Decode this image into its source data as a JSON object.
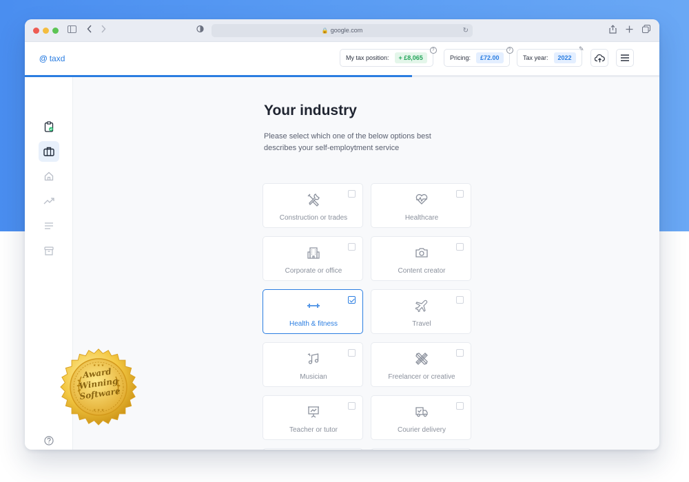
{
  "browser": {
    "url": "google.com"
  },
  "app": {
    "logo_text": "taxd",
    "tax_position": {
      "label": "My tax position:",
      "value": "+ £8,065"
    },
    "pricing": {
      "label": "Pricing:",
      "value": "£72.00"
    },
    "tax_year": {
      "label": "Tax year:",
      "value": "2022"
    },
    "progress_fraction": 0.61
  },
  "sidebar": {
    "items": [
      {
        "icon": "clipboard-check-icon",
        "active": false
      },
      {
        "icon": "briefcase-icon",
        "active": true
      },
      {
        "icon": "home-icon",
        "active": false
      },
      {
        "icon": "trending-up-icon",
        "active": false
      },
      {
        "icon": "list-icon",
        "active": false
      },
      {
        "icon": "archive-icon",
        "active": false
      }
    ],
    "help_icon": "help-icon"
  },
  "main": {
    "title": "Your industry",
    "subtitle": "Please select which one of the below options best describes your self-employtment service",
    "options": [
      {
        "label": "Construction or trades",
        "icon": "tools-icon",
        "selected": false
      },
      {
        "label": "Healthcare",
        "icon": "heartbeat-icon",
        "selected": false
      },
      {
        "label": "Corporate or office",
        "icon": "building-icon",
        "selected": false
      },
      {
        "label": "Content creator",
        "icon": "camera-icon",
        "selected": false
      },
      {
        "label": "Health & fitness",
        "icon": "dumbbell-icon",
        "selected": true
      },
      {
        "label": "Travel",
        "icon": "airplane-icon",
        "selected": false
      },
      {
        "label": "Musician",
        "icon": "music-note-icon",
        "selected": false
      },
      {
        "label": "Freelancer or creative",
        "icon": "pencil-ruler-icon",
        "selected": false
      },
      {
        "label": "Teacher or tutor",
        "icon": "presentation-board-icon",
        "selected": false
      },
      {
        "label": "Courier delivery",
        "icon": "delivery-truck-icon",
        "selected": false
      },
      {
        "label": "",
        "icon": "shield-star-icon",
        "selected": false
      },
      {
        "label": "",
        "icon": "mechanic-icon",
        "selected": false
      }
    ]
  },
  "badge": {
    "line1": "Award",
    "line2": "Winning",
    "line3": "Software"
  },
  "colors": {
    "accent": "#2a7de1",
    "positive": "#23a55a",
    "background_gradient": "#4a8ef0"
  }
}
